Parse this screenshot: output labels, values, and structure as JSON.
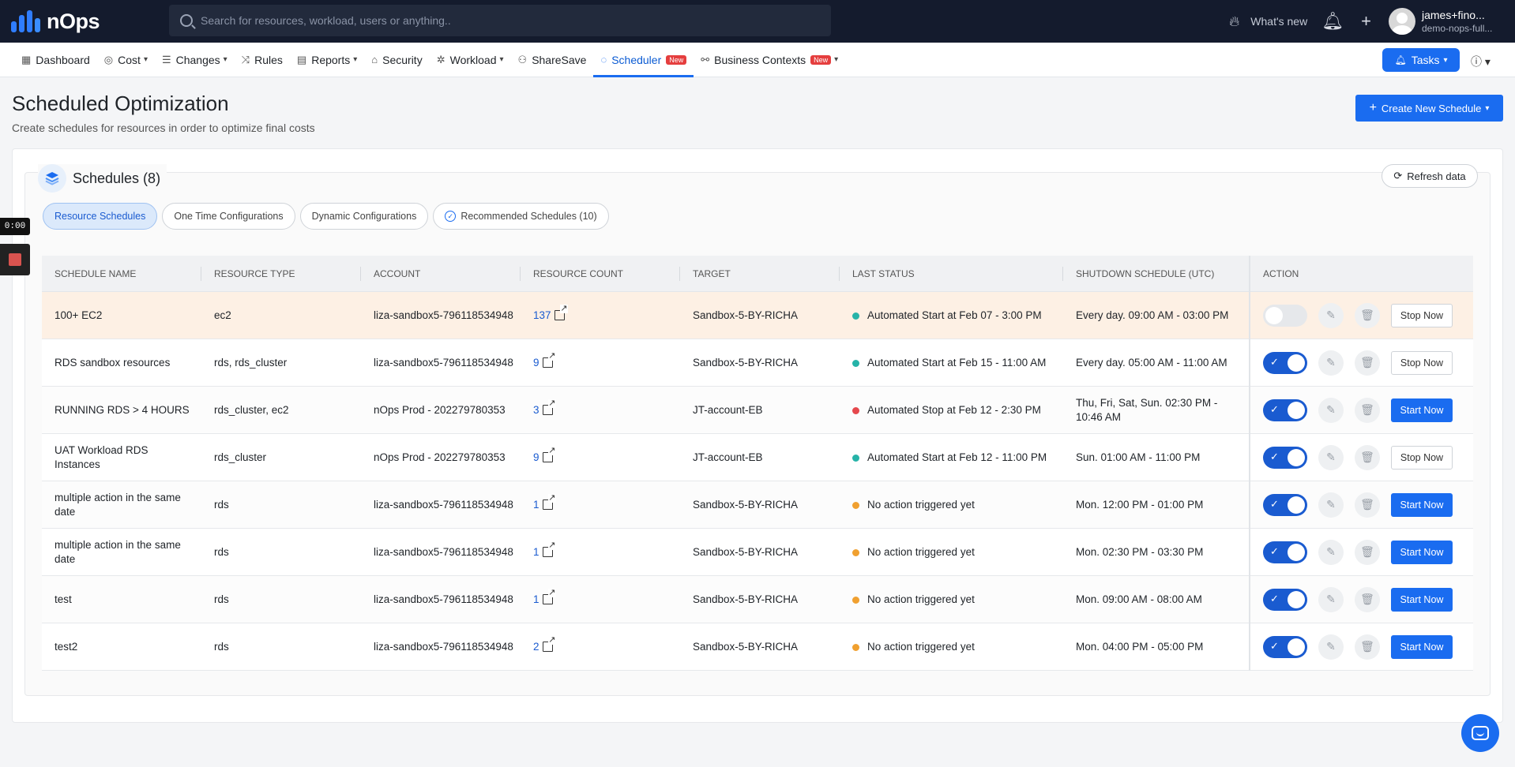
{
  "topbar": {
    "logo_text": "nOps",
    "search_placeholder": "Search for resources, workload, users or anything..",
    "whats_new": "What's new",
    "user_name": "james+fino...",
    "user_org": "demo-nops-full..."
  },
  "nav": {
    "items": [
      {
        "label": "Dashboard",
        "icon": "dashboard-icon"
      },
      {
        "label": "Cost",
        "icon": "cost-icon"
      },
      {
        "label": "Changes",
        "icon": "changes-icon"
      },
      {
        "label": "Rules",
        "icon": "rules-icon"
      },
      {
        "label": "Reports",
        "icon": "reports-icon"
      },
      {
        "label": "Security",
        "icon": "security-icon"
      },
      {
        "label": "Workload",
        "icon": "workload-icon"
      },
      {
        "label": "ShareSave",
        "icon": "sharesave-icon"
      },
      {
        "label": "Scheduler",
        "icon": "scheduler-icon"
      },
      {
        "label": "Business Contexts",
        "icon": "business-contexts-icon"
      }
    ],
    "new_badge": "New",
    "tasks_label": "Tasks"
  },
  "page": {
    "title": "Scheduled Optimization",
    "subtitle": "Create schedules for resources in order to optimize final costs",
    "create_button": "Create New Schedule"
  },
  "schedules": {
    "title": "Schedules (8)",
    "refresh_label": "Refresh data",
    "tabs": [
      "Resource Schedules",
      "One Time Configurations",
      "Dynamic Configurations",
      "Recommended Schedules (10)"
    ]
  },
  "table": {
    "headers": [
      "SCHEDULE NAME",
      "RESOURCE TYPE",
      "ACCOUNT",
      "RESOURCE COUNT",
      "TARGET",
      "LAST STATUS",
      "SHUTDOWN SCHEDULE (UTC)",
      "ACTION"
    ],
    "rows": [
      {
        "name": "100+ EC2",
        "type": "ec2",
        "account": "liza-sandbox5-796118534948",
        "count": "137",
        "target": "Sandbox-5-BY-RICHA",
        "status": "Automated Start at Feb 07 - 3:00 PM",
        "status_color": "#26b3a8",
        "schedule": "Every day. 09:00 AM - 03:00 PM",
        "enabled": false,
        "action": "Stop Now"
      },
      {
        "name": "RDS sandbox resources",
        "type": "rds, rds_cluster",
        "account": "liza-sandbox5-796118534948",
        "count": "9",
        "target": "Sandbox-5-BY-RICHA",
        "status": "Automated Start at Feb 15 - 11:00 AM",
        "status_color": "#26b3a8",
        "schedule": "Every day. 05:00 AM - 11:00 AM",
        "enabled": true,
        "action": "Stop Now"
      },
      {
        "name": "RUNNING RDS > 4 HOURS",
        "type": "rds_cluster, ec2",
        "account": "nOps Prod - 202279780353",
        "count": "3",
        "target": "JT-account-EB",
        "status": "Automated Stop at Feb 12 - 2:30 PM",
        "status_color": "#e5484d",
        "schedule": "Thu, Fri, Sat, Sun. 02:30 PM - 10:46 AM",
        "enabled": true,
        "action": "Start Now"
      },
      {
        "name": "UAT Workload RDS Instances",
        "type": "rds_cluster",
        "account": "nOps Prod - 202279780353",
        "count": "9",
        "target": "JT-account-EB",
        "status": "Automated Start at Feb 12 - 11:00 PM",
        "status_color": "#26b3a8",
        "schedule": "Sun. 01:00 AM - 11:00 PM",
        "enabled": true,
        "action": "Stop Now"
      },
      {
        "name": "multiple action in the same date",
        "type": "rds",
        "account": "liza-sandbox5-796118534948",
        "count": "1",
        "target": "Sandbox-5-BY-RICHA",
        "status": "No action triggered yet",
        "status_color": "#f0a030",
        "schedule": "Mon. 12:00 PM - 01:00 PM",
        "enabled": true,
        "action": "Start Now"
      },
      {
        "name": "multiple action in the same date",
        "type": "rds",
        "account": "liza-sandbox5-796118534948",
        "count": "1",
        "target": "Sandbox-5-BY-RICHA",
        "status": "No action triggered yet",
        "status_color": "#f0a030",
        "schedule": "Mon. 02:30 PM - 03:30 PM",
        "enabled": true,
        "action": "Start Now"
      },
      {
        "name": "test",
        "type": "rds",
        "account": "liza-sandbox5-796118534948",
        "count": "1",
        "target": "Sandbox-5-BY-RICHA",
        "status": "No action triggered yet",
        "status_color": "#f0a030",
        "schedule": "Mon. 09:00 AM - 08:00 AM",
        "enabled": true,
        "action": "Start Now"
      },
      {
        "name": "test2",
        "type": "rds",
        "account": "liza-sandbox5-796118534948",
        "count": "2",
        "target": "Sandbox-5-BY-RICHA",
        "status": "No action triggered yet",
        "status_color": "#f0a030",
        "schedule": "Mon. 04:00 PM - 05:00 PM",
        "enabled": true,
        "action": "Start Now"
      }
    ]
  },
  "recorder": {
    "time": "0:00"
  },
  "colors": {
    "accent": "#1a6cf0",
    "topbar": "#141b2d",
    "highlight_row": "#fdf0e4"
  }
}
